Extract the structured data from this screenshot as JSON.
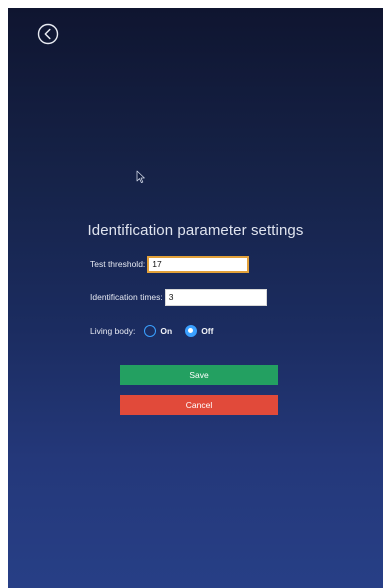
{
  "screen": {
    "title": "Identification parameter settings"
  },
  "fields": {
    "test_threshold": {
      "label": "Test threshold:",
      "value": "17"
    },
    "identification_times": {
      "label": "Identification times:",
      "value": "3"
    }
  },
  "living_body": {
    "label": "Living body:",
    "options": [
      {
        "label": "On",
        "selected": false
      },
      {
        "label": "Off",
        "selected": true
      }
    ]
  },
  "buttons": {
    "save_label": "Save",
    "cancel_label": "Cancel"
  },
  "icons": {
    "back": "back-arrow-circle-icon",
    "cursor": "mouse-pointer-icon"
  },
  "colors": {
    "background_top": "#0f1530",
    "background_bottom": "#273f86",
    "save_button": "#23a061",
    "cancel_button": "#e14a3a",
    "radio_accent": "#3aa0ff",
    "focused_input_border": "#e2a13a"
  }
}
